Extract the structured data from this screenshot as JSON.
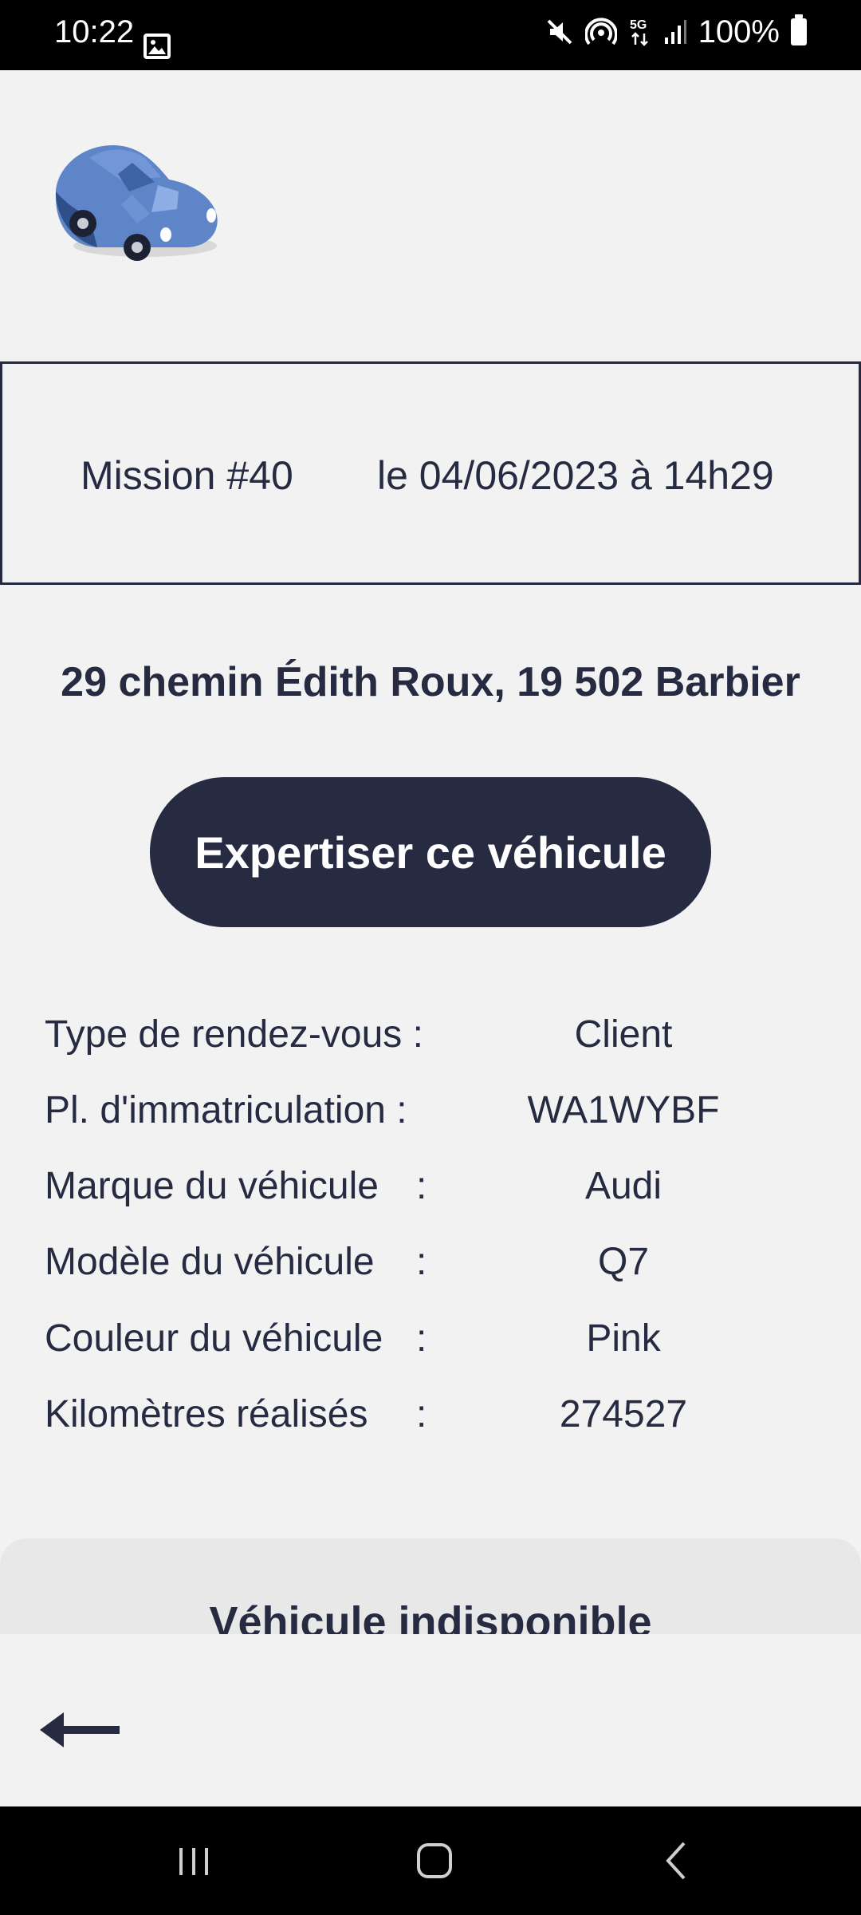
{
  "status_bar": {
    "time": "10:22",
    "network": "5G",
    "battery": "100%",
    "icons": [
      "gallery-icon",
      "mute-icon",
      "hotspot-icon",
      "5g-data-icon",
      "signal-icon",
      "battery-icon"
    ]
  },
  "mission": {
    "number": "Mission #40",
    "date": "le 04/06/2023 à 14h29"
  },
  "address": "29 chemin Édith Roux, 19 502 Barbier",
  "primary_button": "Expertiser ce véhicule",
  "details": [
    {
      "label": "Type de rendez-vous :",
      "colon": "",
      "value": "Client"
    },
    {
      "label": "Pl. d'immatriculation :",
      "colon": "",
      "value": "WA1WYBF"
    },
    {
      "label": "Marque du véhicule",
      "colon": ":",
      "value": "Audi"
    },
    {
      "label": "Modèle du véhicule",
      "colon": ":",
      "value": "Q7"
    },
    {
      "label": "Couleur du véhicule",
      "colon": ":",
      "value": "Pink"
    },
    {
      "label": "Kilomètres réalisés",
      "colon": ":",
      "value": "274527"
    }
  ],
  "unavailable_card": {
    "title": "Véhicule indisponible"
  },
  "colors": {
    "primary": "#262b42",
    "background": "#f2f2f2",
    "car_body": "#5f85c9"
  }
}
